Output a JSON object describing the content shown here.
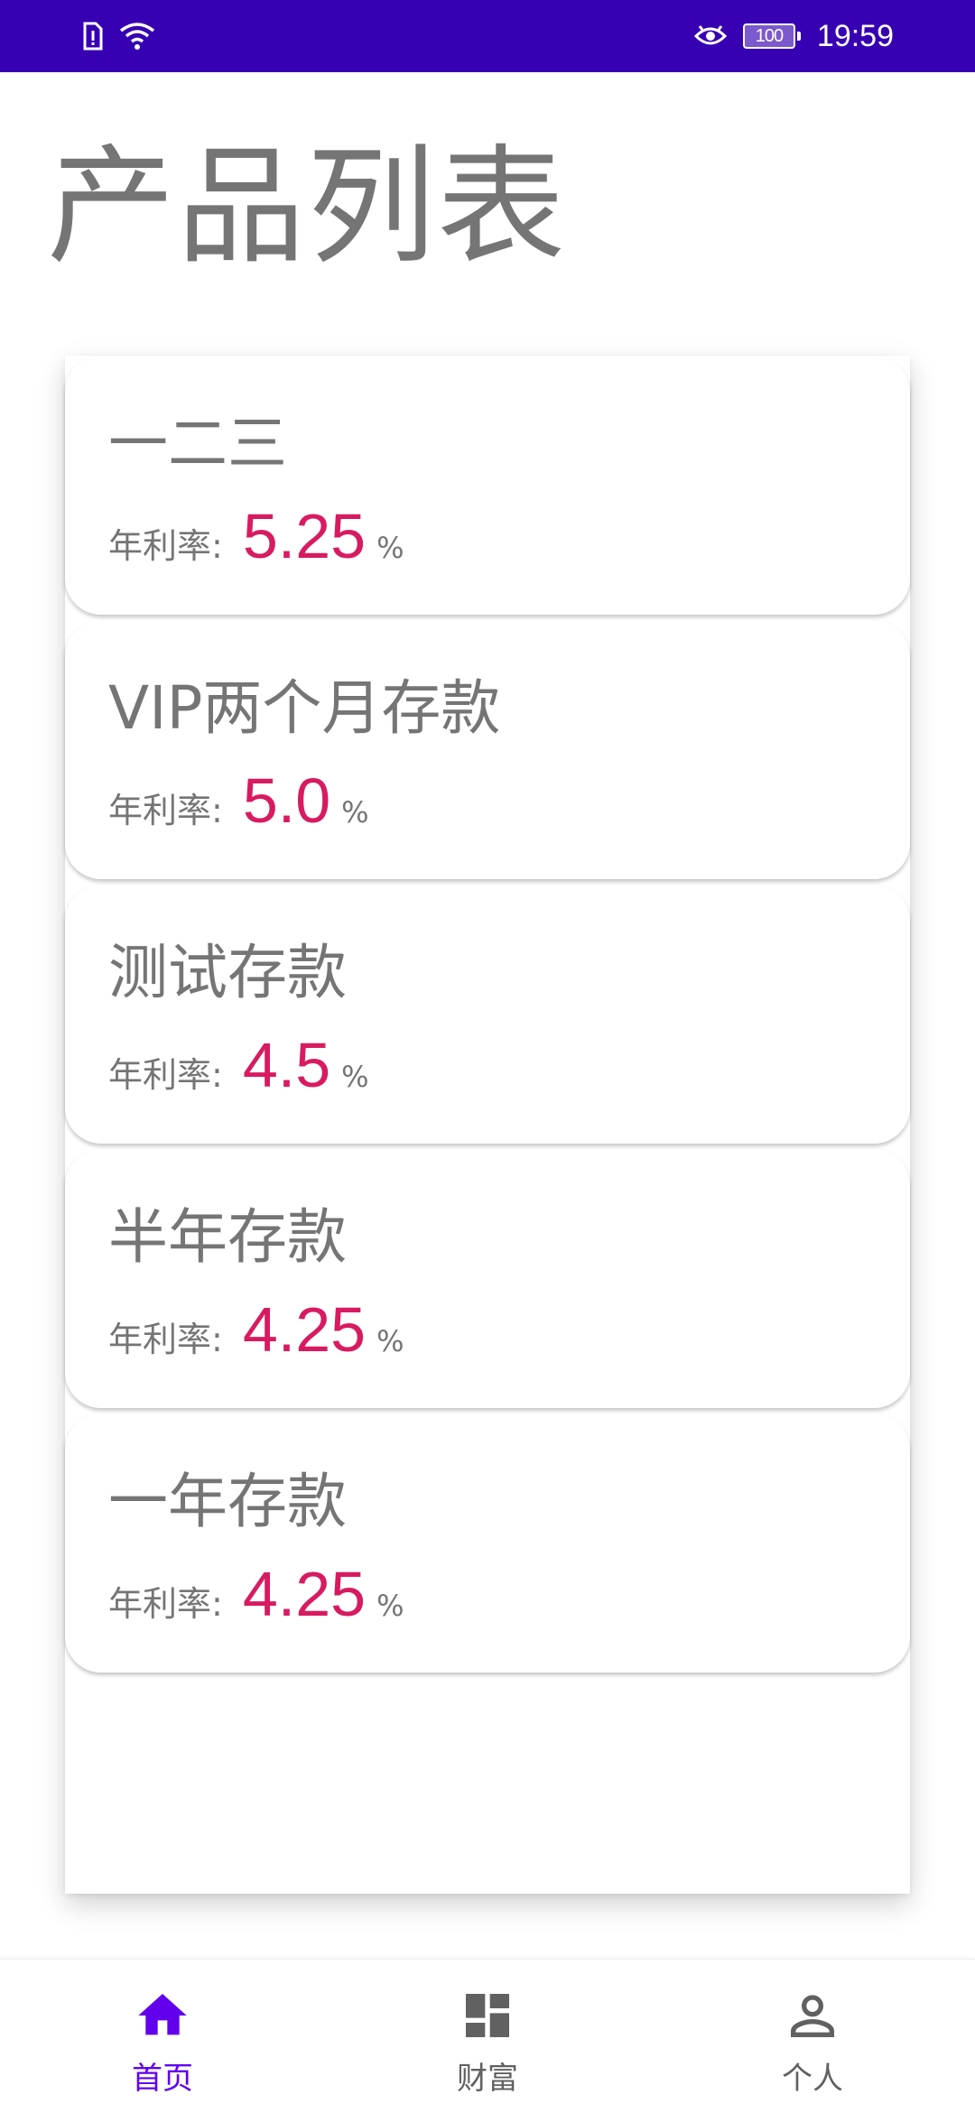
{
  "status_bar": {
    "time": "19:59",
    "battery_level": "100",
    "icons": [
      "sim-alert-icon",
      "wifi-icon",
      "eye-icon",
      "battery-icon"
    ]
  },
  "page": {
    "title": "产品列表"
  },
  "products": [
    {
      "name": "一二三",
      "rate_label": "年利率:",
      "rate": "5.25",
      "unit": "%"
    },
    {
      "name": "VIP两个月存款",
      "rate_label": "年利率:",
      "rate": "5.0",
      "unit": "%"
    },
    {
      "name": "测试存款",
      "rate_label": "年利率:",
      "rate": "4.5",
      "unit": "%"
    },
    {
      "name": "半年存款",
      "rate_label": "年利率:",
      "rate": "4.25",
      "unit": "%"
    },
    {
      "name": "一年存款",
      "rate_label": "年利率:",
      "rate": "4.25",
      "unit": "%"
    }
  ],
  "bottom_nav": {
    "items": [
      {
        "label": "首页",
        "icon": "home-icon",
        "active": true
      },
      {
        "label": "财富",
        "icon": "dashboard-icon",
        "active": false
      },
      {
        "label": "个人",
        "icon": "person-icon",
        "active": false
      }
    ]
  },
  "colors": {
    "status_bar": "#3700B3",
    "accent": "#6200EE",
    "rate": "#D81B60",
    "text_secondary": "#757575"
  }
}
